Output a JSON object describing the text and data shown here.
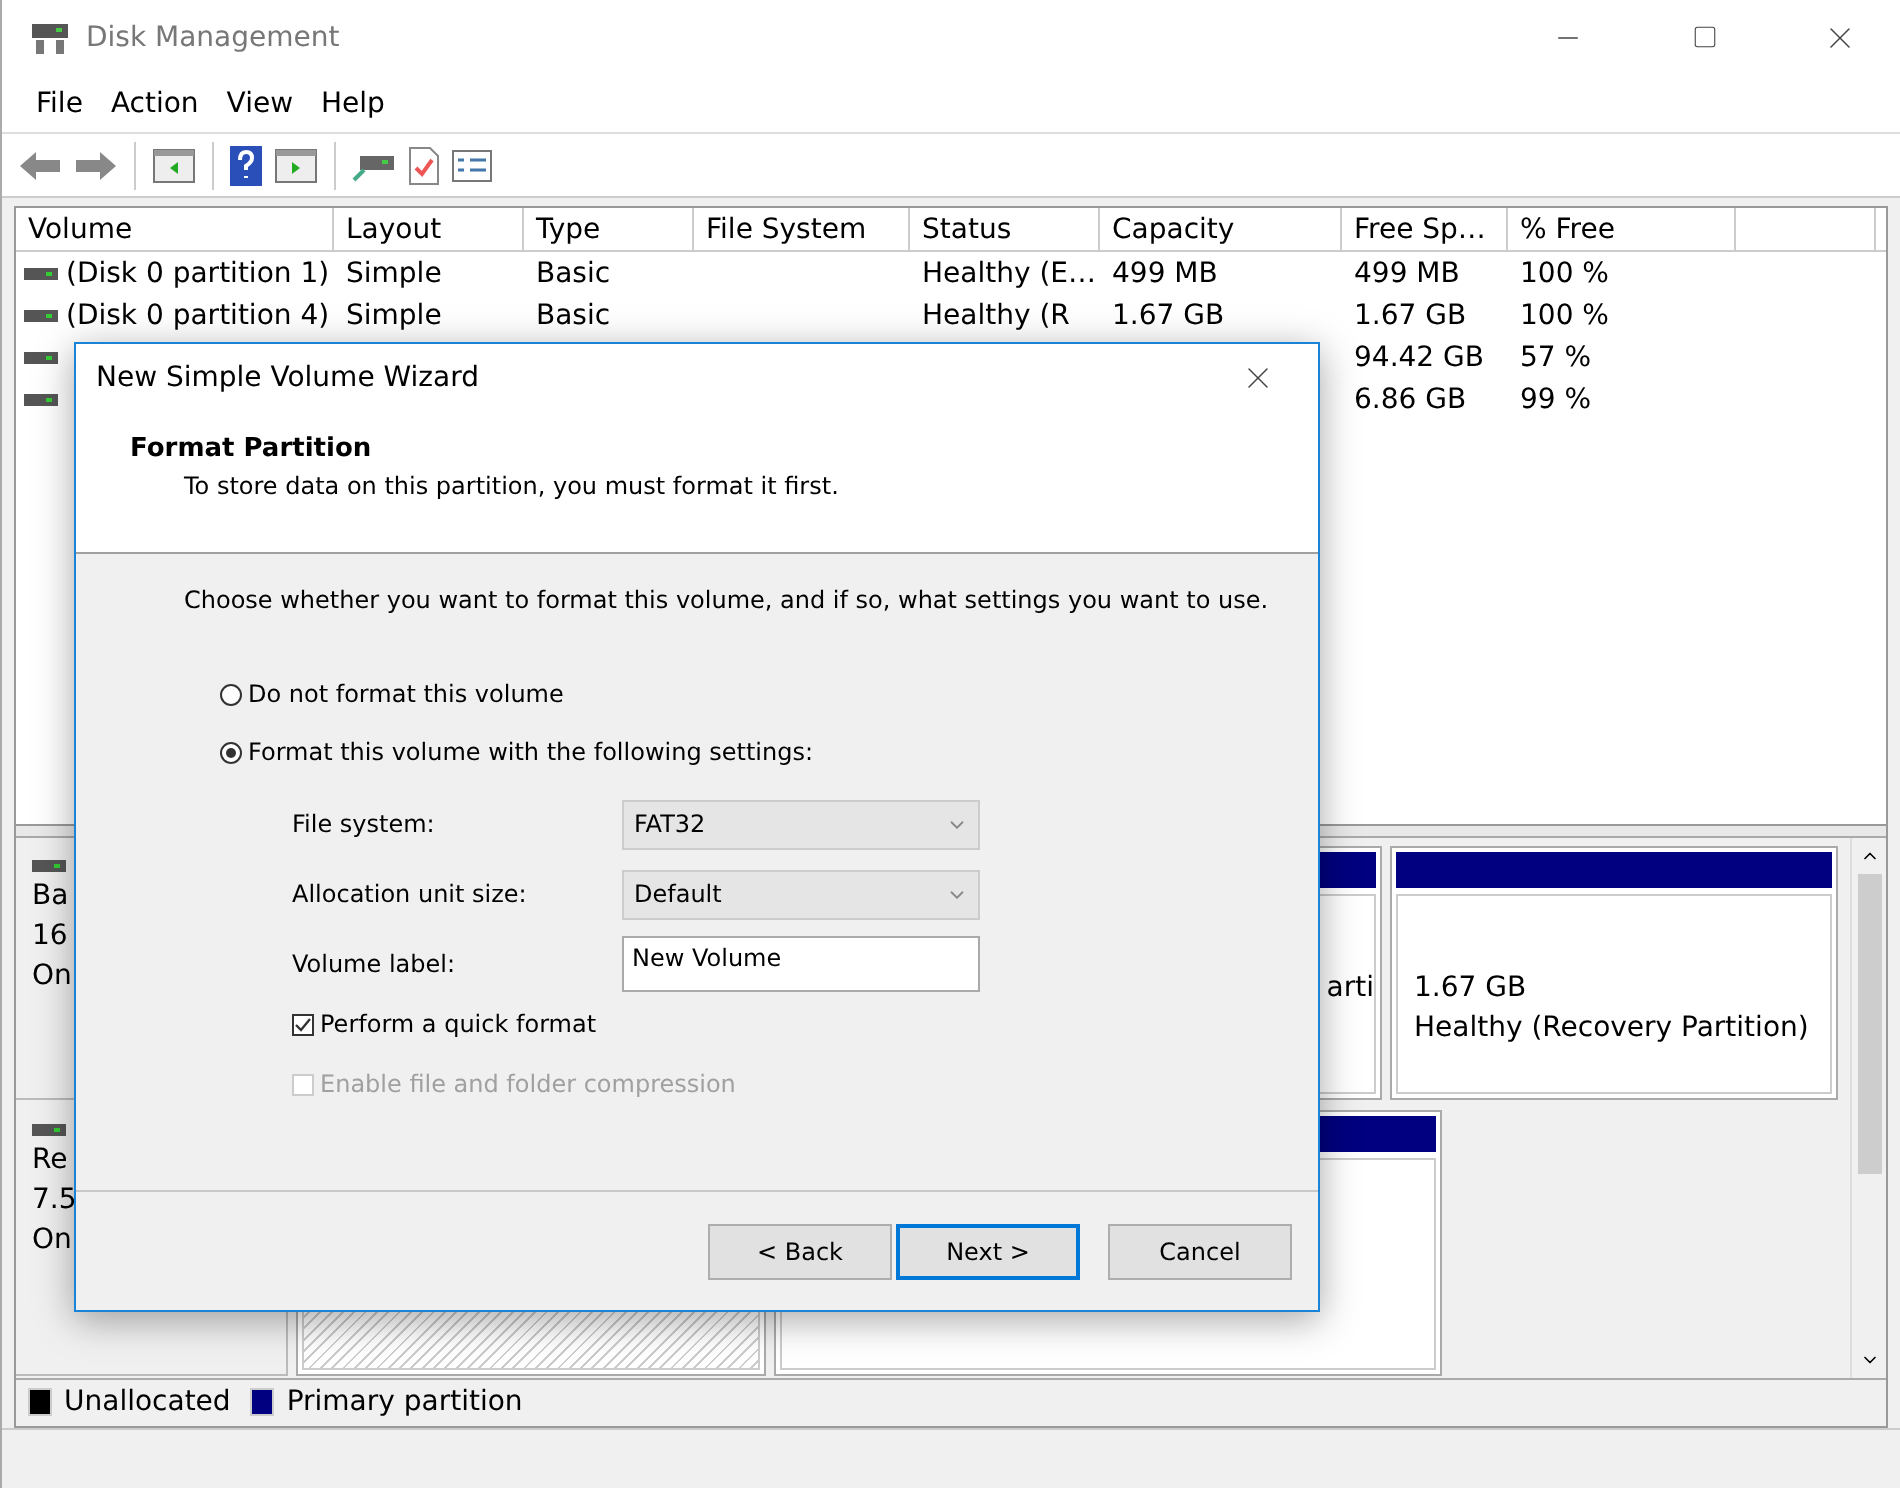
{
  "window": {
    "title": "Disk Management"
  },
  "menu": [
    "File",
    "Action",
    "View",
    "Help"
  ],
  "volume_table": {
    "columns": [
      "Volume",
      "Layout",
      "Type",
      "File System",
      "Status",
      "Capacity",
      "Free Sp…",
      "% Free"
    ],
    "rows": [
      {
        "volume": "(Disk 0 partition 1)",
        "layout": "Simple",
        "type": "Basic",
        "status": "Healthy (E…",
        "capacity": "499 MB",
        "free": "499 MB",
        "percent_free": "100 %"
      },
      {
        "volume": "(Disk 0 partition 4)",
        "layout": "Simple",
        "type": "Basic",
        "status": "Healthy (R",
        "capacity": "1.67 GB",
        "free": "1.67 GB",
        "percent_free": "100 %"
      },
      {
        "free": "94.42 GB",
        "percent_free": "57 %"
      },
      {
        "free": "6.86 GB",
        "percent_free": "99 %"
      }
    ]
  },
  "disks": [
    {
      "label_lines": [
        "Ba",
        "16",
        "On"
      ],
      "partitions": [
        {
          "kind": "primary",
          "texts": [
            "arti"
          ]
        },
        {
          "kind": "primary",
          "texts": [
            "1.67 GB",
            "Healthy (Recovery Partition)"
          ]
        }
      ]
    },
    {
      "label_lines": [
        "Re",
        "7.5",
        "On"
      ],
      "partitions": [
        {
          "kind": "unallocated"
        },
        {
          "kind": "primary"
        }
      ]
    }
  ],
  "legend": [
    {
      "label": "Unallocated",
      "color": "#000000"
    },
    {
      "label": "Primary partition",
      "color": "#000080"
    }
  ],
  "dialog": {
    "title": "New Simple Volume Wizard",
    "heading": "Format Partition",
    "subheading": "To store data on this partition, you must format it first.",
    "prompt": "Choose whether you want to format this volume, and if so, what settings you want to use.",
    "options": [
      {
        "label": "Do not format this volume",
        "selected": false
      },
      {
        "label": "Format this volume with the following settings:",
        "selected": true
      }
    ],
    "fields": [
      {
        "kind": "select",
        "label": "File system:",
        "value": "FAT32"
      },
      {
        "kind": "select",
        "label": "Allocation unit size:",
        "value": "Default"
      },
      {
        "kind": "text",
        "label": "Volume label:",
        "value": "New Volume"
      }
    ],
    "checks": [
      {
        "label": "Perform a quick format",
        "checked": true,
        "disabled": false
      },
      {
        "label": "Enable file and folder compression",
        "checked": false,
        "disabled": true
      }
    ],
    "buttons": [
      {
        "label": "< Back",
        "default": false
      },
      {
        "label": "Next >",
        "default": true
      },
      {
        "label": "Cancel",
        "default": false
      }
    ]
  }
}
